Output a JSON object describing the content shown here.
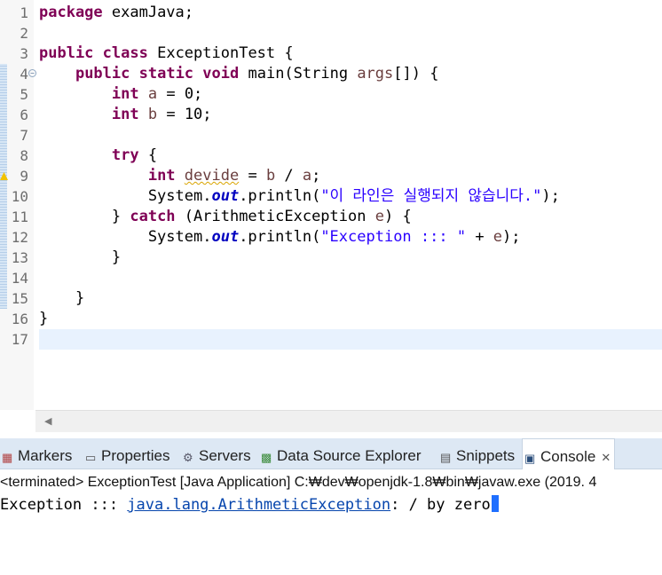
{
  "editor": {
    "lines": [
      {
        "num": "1",
        "segs": [
          {
            "t": "package",
            "c": "kw"
          },
          {
            "t": " examJava;",
            "c": ""
          }
        ]
      },
      {
        "num": "2",
        "segs": []
      },
      {
        "num": "3",
        "segs": [
          {
            "t": "public",
            "c": "kw"
          },
          {
            "t": " ",
            "c": ""
          },
          {
            "t": "class",
            "c": "kw"
          },
          {
            "t": " ExceptionTest {",
            "c": ""
          }
        ]
      },
      {
        "num": "4",
        "fold": "true",
        "segs": [
          {
            "t": "    ",
            "c": ""
          },
          {
            "t": "public",
            "c": "kw"
          },
          {
            "t": " ",
            "c": ""
          },
          {
            "t": "static",
            "c": "kw"
          },
          {
            "t": " ",
            "c": ""
          },
          {
            "t": "void",
            "c": "kw"
          },
          {
            "t": " main(String ",
            "c": ""
          },
          {
            "t": "args",
            "c": "var"
          },
          {
            "t": "[]) {",
            "c": ""
          }
        ]
      },
      {
        "num": "5",
        "segs": [
          {
            "t": "        ",
            "c": ""
          },
          {
            "t": "int",
            "c": "kw"
          },
          {
            "t": " ",
            "c": ""
          },
          {
            "t": "a",
            "c": "var"
          },
          {
            "t": " = 0;",
            "c": ""
          }
        ]
      },
      {
        "num": "6",
        "segs": [
          {
            "t": "        ",
            "c": ""
          },
          {
            "t": "int",
            "c": "kw"
          },
          {
            "t": " ",
            "c": ""
          },
          {
            "t": "b",
            "c": "var"
          },
          {
            "t": " = 10;",
            "c": ""
          }
        ]
      },
      {
        "num": "7",
        "segs": []
      },
      {
        "num": "8",
        "segs": [
          {
            "t": "        ",
            "c": ""
          },
          {
            "t": "try",
            "c": "kw"
          },
          {
            "t": " {",
            "c": ""
          }
        ]
      },
      {
        "num": "9",
        "warning": "true",
        "segs": [
          {
            "t": "            ",
            "c": ""
          },
          {
            "t": "int",
            "c": "kw"
          },
          {
            "t": " ",
            "c": ""
          },
          {
            "t": "devide",
            "c": "var warn"
          },
          {
            "t": " = ",
            "c": ""
          },
          {
            "t": "b",
            "c": "var"
          },
          {
            "t": " / ",
            "c": ""
          },
          {
            "t": "a",
            "c": "var"
          },
          {
            "t": ";",
            "c": ""
          }
        ]
      },
      {
        "num": "10",
        "segs": [
          {
            "t": "            System.",
            "c": ""
          },
          {
            "t": "out",
            "c": "fld"
          },
          {
            "t": ".println(",
            "c": ""
          },
          {
            "t": "\"이 라인은 실행되지 않습니다.\"",
            "c": "str"
          },
          {
            "t": ");",
            "c": ""
          }
        ]
      },
      {
        "num": "11",
        "segs": [
          {
            "t": "        } ",
            "c": ""
          },
          {
            "t": "catch",
            "c": "kw"
          },
          {
            "t": " (ArithmeticException ",
            "c": ""
          },
          {
            "t": "e",
            "c": "var"
          },
          {
            "t": ") {",
            "c": ""
          }
        ]
      },
      {
        "num": "12",
        "segs": [
          {
            "t": "            System.",
            "c": ""
          },
          {
            "t": "out",
            "c": "fld"
          },
          {
            "t": ".println(",
            "c": ""
          },
          {
            "t": "\"Exception ::: \"",
            "c": "str"
          },
          {
            "t": " + ",
            "c": ""
          },
          {
            "t": "e",
            "c": "var"
          },
          {
            "t": ");",
            "c": ""
          }
        ]
      },
      {
        "num": "13",
        "segs": [
          {
            "t": "        }",
            "c": ""
          }
        ]
      },
      {
        "num": "14",
        "segs": []
      },
      {
        "num": "15",
        "segs": [
          {
            "t": "    }",
            "c": ""
          }
        ]
      },
      {
        "num": "16",
        "segs": [
          {
            "t": "}",
            "c": ""
          }
        ]
      },
      {
        "num": "17",
        "segs": []
      }
    ]
  },
  "tabs": [
    {
      "id": "markers",
      "label": "Markers",
      "icon": "markers-icon"
    },
    {
      "id": "properties",
      "label": "Properties",
      "icon": "properties-icon"
    },
    {
      "id": "servers",
      "label": "Servers",
      "icon": "servers-icon"
    },
    {
      "id": "data-source-explorer",
      "label": "Data Source Explorer",
      "icon": "data-source-icon"
    },
    {
      "id": "snippets",
      "label": "Snippets",
      "icon": "snippets-icon"
    },
    {
      "id": "console",
      "label": "Console",
      "icon": "console-icon",
      "active": true,
      "close": "✕"
    }
  ],
  "console": {
    "header": "<terminated> ExceptionTest [Java Application] C:₩dev₩openjdk-1.8₩bin₩javaw.exe (2019. 4",
    "output_prefix": "Exception ::: ",
    "output_link": "java.lang.ArithmeticException",
    "output_suffix": ": / by zero"
  },
  "colors": {
    "keyword": "#7f0055",
    "string": "#2a00ff",
    "field": "#0000c0",
    "local_var": "#6a3e3e",
    "tab_bar": "#dde8f4",
    "current_line": "#e8f2fe"
  }
}
